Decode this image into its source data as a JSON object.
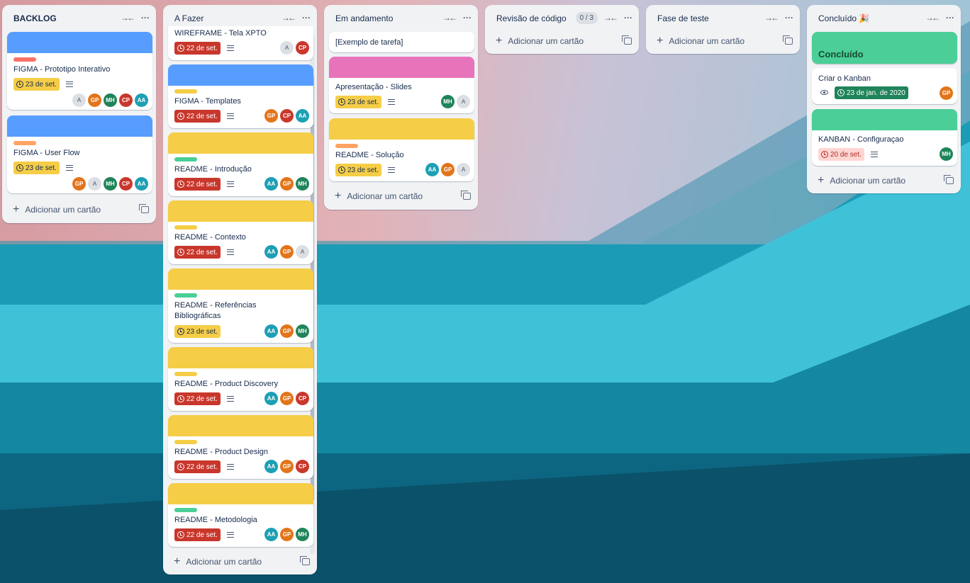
{
  "board": {
    "lists": [
      {
        "id": "backlog",
        "title": "BACKLOG",
        "add_label": "Adicionar um cartão",
        "cards": [
          {
            "title": "FIGMA - Prototipo Interativo",
            "due": "23 de set."
          },
          {
            "title": "FIGMA - User Flow",
            "due": "23 de set."
          }
        ]
      },
      {
        "id": "a-fazer",
        "title": "A Fazer",
        "add_label": "Adicionar um cartão",
        "cards": [
          {
            "title": "WIREFRAME - Tela XPTO",
            "due": "22 de set."
          },
          {
            "title": "FIGMA - Templates",
            "due": "22 de set."
          },
          {
            "title": "README - Introdução",
            "due": "22 de set."
          },
          {
            "title": "README - Contexto",
            "due": "22 de set."
          },
          {
            "title": "README - Referências Bibliográficas",
            "due": "23 de set."
          },
          {
            "title": "README - Product Discovery",
            "due": "22 de set."
          },
          {
            "title": "README - Product Design",
            "due": "22 de set."
          },
          {
            "title": "README - Metodologia",
            "due": "22 de set."
          }
        ]
      },
      {
        "id": "em-andamento",
        "title": "Em andamento",
        "add_label": "Adicionar um cartão",
        "cards": [
          {
            "title": "[Exemplo de tarefa]"
          },
          {
            "title": "Apresentação - Slides",
            "due": "23 de set."
          },
          {
            "title": "README - Solução",
            "due": "23 de set."
          }
        ]
      },
      {
        "id": "revisao",
        "title": "Revisão de código",
        "count": "0 / 3",
        "add_label": "Adicionar um cartão"
      },
      {
        "id": "teste",
        "title": "Fase de teste",
        "add_label": "Adicionar um cartão"
      },
      {
        "id": "concluido",
        "title": "Concluído 🎉",
        "add_label": "Adicionar um cartão",
        "cards": [
          {
            "title": "Concluído"
          },
          {
            "title": "Criar o Kanban",
            "due": "23 de jan. de 2020"
          },
          {
            "title": "KANBAN - Configuraçao",
            "due": "20 de set."
          }
        ]
      }
    ],
    "members": {
      "A": "A",
      "GP": "GP",
      "MH": "MH",
      "CP": "CP",
      "AA": "AA"
    },
    "colors": {
      "cover_blue": "#579dff",
      "cover_pink": "#e774bb",
      "cover_yellow": "#f5cd47",
      "cover_green": "#4bce97",
      "label_red": "#f87168",
      "label_orange": "#fea362",
      "label_yellow": "#f5cd47",
      "label_green": "#4bce97"
    },
    "icons": [
      "collapse-icon",
      "more-icon",
      "clock-icon",
      "description-icon",
      "eye-icon",
      "template-icon",
      "plus-icon"
    ]
  }
}
